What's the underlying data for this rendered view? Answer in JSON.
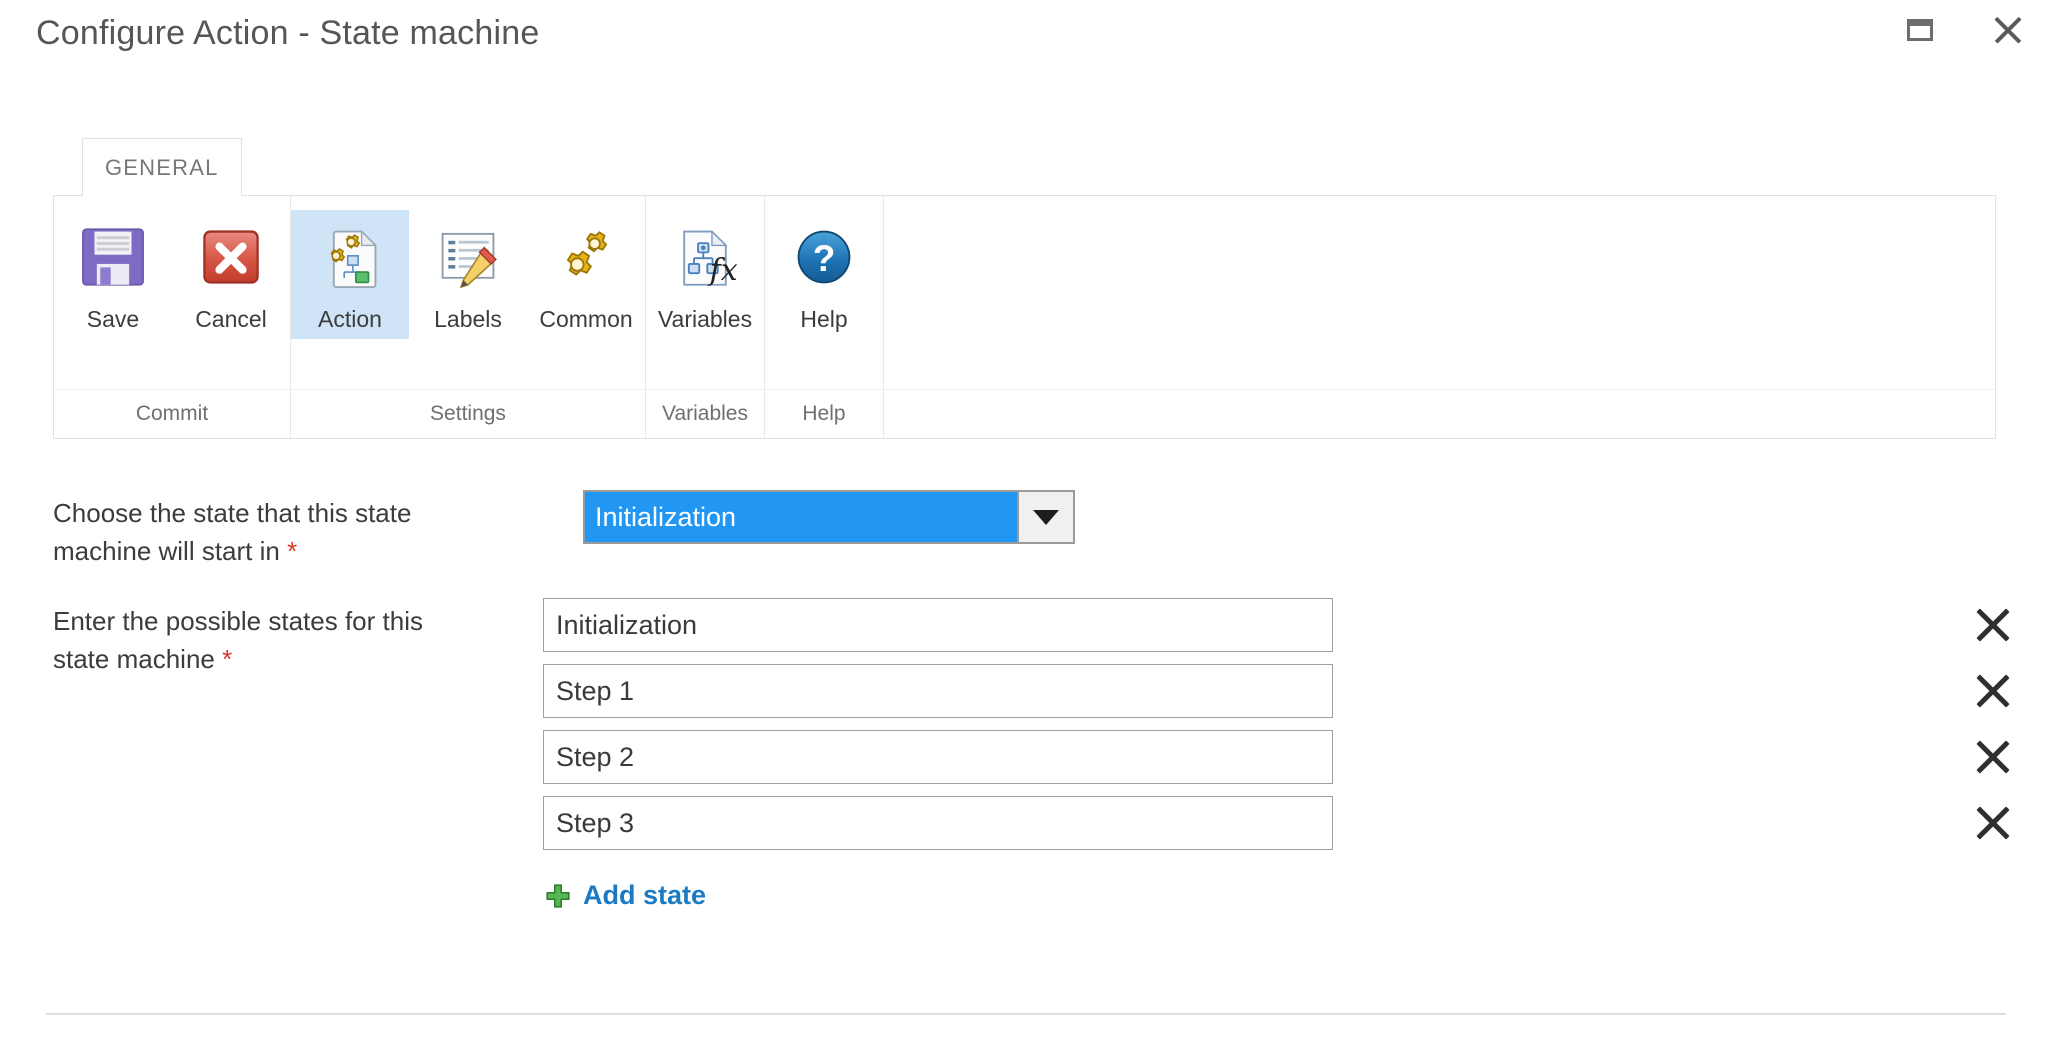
{
  "window": {
    "title": "Configure Action - State machine",
    "maximize_icon": "maximize-icon",
    "close_icon": "close-icon"
  },
  "ribbon": {
    "tabs": [
      {
        "label": "GENERAL",
        "active": true
      }
    ],
    "groups": [
      {
        "label": "Commit",
        "buttons": [
          {
            "label": "Save",
            "icon": "floppy-disk-icon",
            "selected": false
          },
          {
            "label": "Cancel",
            "icon": "red-x-icon",
            "selected": false
          }
        ]
      },
      {
        "label": "Settings",
        "buttons": [
          {
            "label": "Action",
            "icon": "gears-document-icon",
            "selected": true
          },
          {
            "label": "Labels",
            "icon": "list-pencil-icon",
            "selected": false
          },
          {
            "label": "Common",
            "icon": "gears-icon",
            "selected": false
          }
        ]
      },
      {
        "label": "Variables",
        "buttons": [
          {
            "label": "Variables",
            "icon": "document-fx-icon",
            "selected": false
          }
        ]
      },
      {
        "label": "Help",
        "buttons": [
          {
            "label": "Help",
            "icon": "question-circle-icon",
            "selected": false
          }
        ]
      }
    ]
  },
  "form": {
    "start_state": {
      "label_line1": "Choose the state that this state",
      "label_line2": "machine will start in",
      "required_marker": "*",
      "selected_value": "Initialization",
      "dropdown_icon": "chevron-down-icon",
      "highlight_color": "#2196f3"
    },
    "possible_states": {
      "label_line1": "Enter the possible states for this",
      "label_line2": "state machine",
      "required_marker": "*",
      "rows": [
        {
          "value": "Initialization",
          "remove_icon": "close-icon"
        },
        {
          "value": "Step 1",
          "remove_icon": "close-icon"
        },
        {
          "value": "Step 2",
          "remove_icon": "close-icon"
        },
        {
          "value": "Step 3",
          "remove_icon": "close-icon"
        }
      ],
      "add_link": {
        "label": "Add state",
        "icon": "plus-icon",
        "icon_color": "#4caf50",
        "text_color": "#1a7bc4"
      }
    }
  }
}
